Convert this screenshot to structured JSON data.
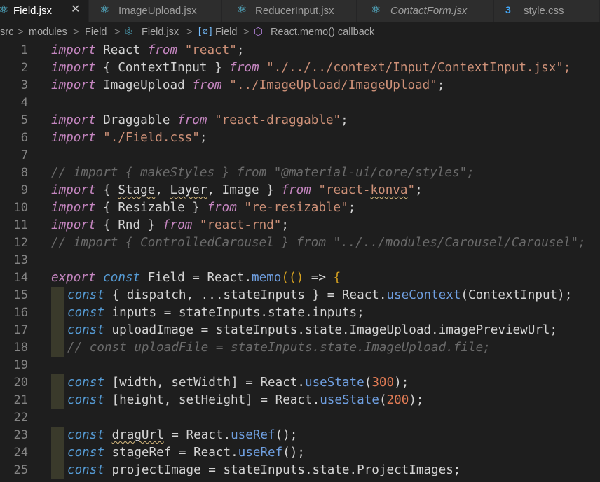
{
  "tabs": [
    {
      "label": "Field.jsx",
      "icon": "react-icon",
      "active": true
    },
    {
      "label": "ImageUpload.jsx",
      "icon": "react-icon",
      "active": false
    },
    {
      "label": "ReducerInput.jsx",
      "icon": "react-icon",
      "active": false
    },
    {
      "label": "ContactForm.jsx",
      "icon": "react-icon",
      "active": false,
      "italic": true
    },
    {
      "label": "style.css",
      "icon": "css-icon",
      "active": false
    }
  ],
  "close_glyph": "✕",
  "breadcrumb": {
    "items": [
      "src",
      "modules",
      "Field",
      "Field.jsx",
      "Field",
      "React.memo() callback"
    ],
    "separator": ">"
  },
  "line_numbers": [
    "1",
    "2",
    "3",
    "4",
    "5",
    "6",
    "7",
    "8",
    "9",
    "10",
    "11",
    "12",
    "13",
    "14",
    "15",
    "16",
    "17",
    "18",
    "19",
    "20",
    "21",
    "22",
    "23",
    "24",
    "25"
  ],
  "tokens": {
    "import": "import",
    "from": "from",
    "export": "export",
    "const": "const",
    "React": "React",
    "ContextInput_braced": "{ ContextInput }",
    "ImageUpload": "ImageUpload",
    "Draggable": "Draggable",
    "Stage": "Stage",
    "Layer": "Layer",
    "Image": "Image",
    "Resizable_braced": "{ Resizable }",
    "Rnd_braced": "{ Rnd }",
    "Field": "Field",
    "memo": "memo",
    "useContext": "useContext",
    "useState": "useState",
    "useRef": "useRef",
    "dragUrl": "dragUrl",
    "stageRef": "stageRef",
    "width": "width",
    "height": "height",
    "setWidth": "setWidth",
    "setHeight": "setHeight",
    "n300": "300",
    "n200": "200"
  },
  "strings": {
    "react": "\"react\"",
    "context_input": "\"./../../context/Input/ContextInput.jsx\";",
    "image_upload": "\"../ImageUpload/ImageUpload\"",
    "react_draggable": "\"react-draggable\"",
    "field_css": "\"./Field.css\"",
    "react_konva_q1": "\"react-",
    "konva": "konva",
    "react_konva_q2": "\"",
    "re_resizable": "\"re-resizable\"",
    "react_rnd": "\"react-rnd\""
  },
  "comments": {
    "line8": "// import { makeStyles } from \"@material-ui/core/styles\";",
    "line12": "// import { ControlledCarousel } from \"../../modules/Carousel/Carousel\";",
    "line18": "// const uploadFile = stateInputs.state.ImageUpload.file;"
  },
  "code": {
    "l15_mid": " { dispatch, ...stateInputs } = React.",
    "l15_end": "ContextInput);",
    "l16": " inputs = stateInputs.state.inputs;",
    "l17": " uploadImage = stateInputs.state.ImageUpload.imagePreviewUrl;",
    "l25": " projectImage = stateInputs.state.ProjectImages;"
  }
}
